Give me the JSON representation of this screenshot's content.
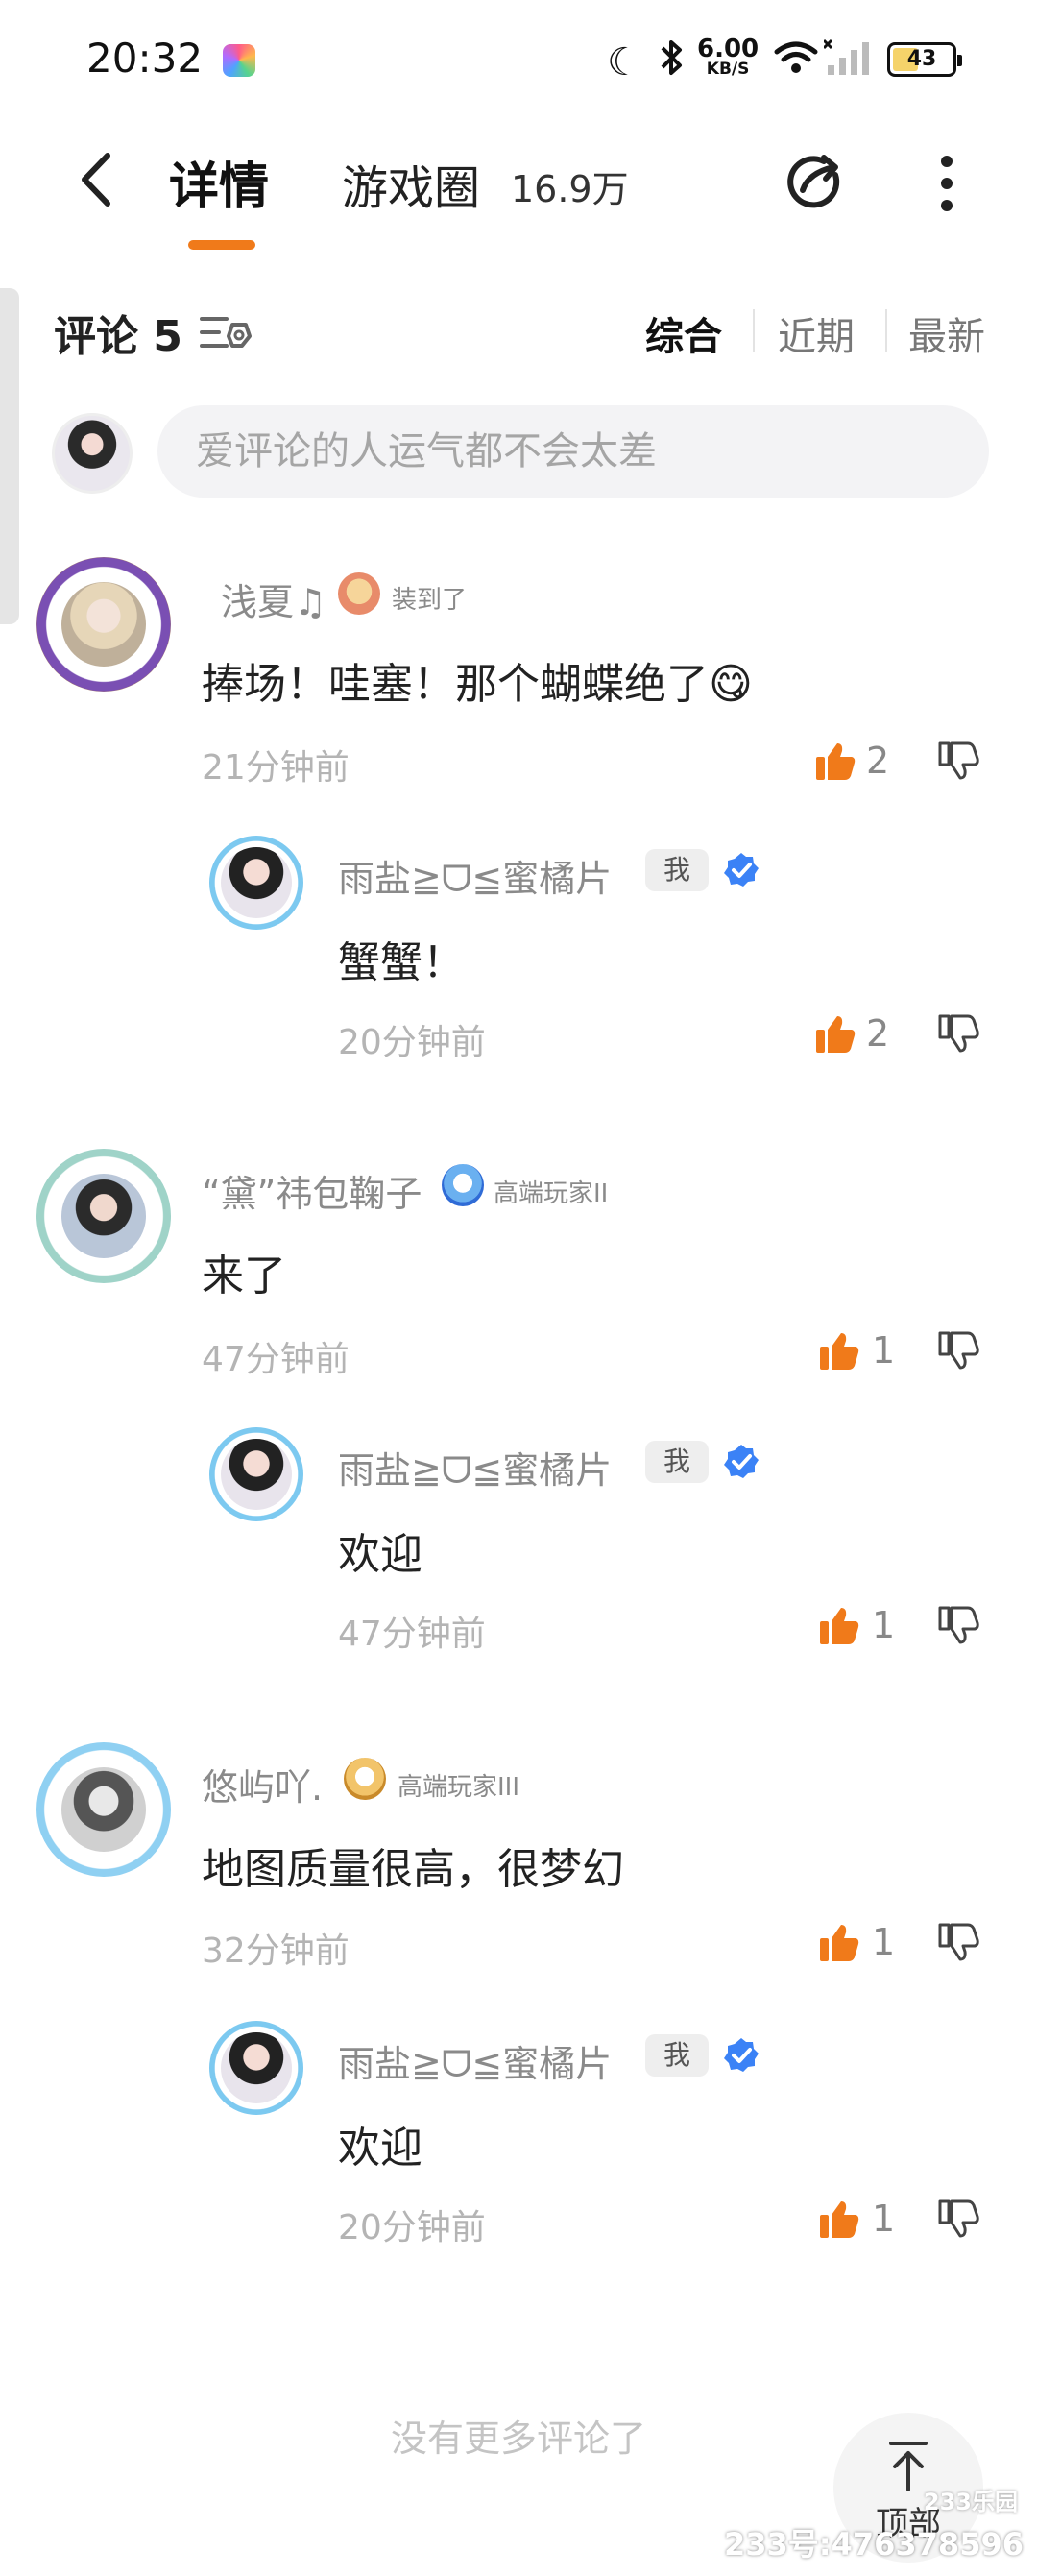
{
  "status_bar": {
    "time": "20:32",
    "net_speed_value": "6.00",
    "net_speed_unit": "KB/S",
    "battery": "43"
  },
  "header": {
    "tab_detail": "详情",
    "tab_circle": "游戏圈",
    "tab_circle_count": "16.9万"
  },
  "comments_header": {
    "title": "评论 5",
    "sort_options": [
      "综合",
      "近期",
      "最新"
    ]
  },
  "input": {
    "placeholder": "爱评论的人运气都不会太差"
  },
  "comments": [
    {
      "user": "浅夏♫",
      "badge": "装到了",
      "text": "捧场！哇塞！那个蝴蝶绝了😋",
      "time": "21分钟前",
      "likes": "2",
      "reply": {
        "user": "雨盐≧ᗜ≦蜜橘片",
        "me_tag": "我",
        "text": "蟹蟹！",
        "time": "20分钟前",
        "likes": "2"
      }
    },
    {
      "user": "“黛”祎包鞠子",
      "badge": "高端玩家II",
      "text": "来了",
      "time": "47分钟前",
      "likes": "1",
      "reply": {
        "user": "雨盐≧ᗜ≦蜜橘片",
        "me_tag": "我",
        "text": "欢迎",
        "time": "47分钟前",
        "likes": "1"
      }
    },
    {
      "user": "悠屿吖.",
      "badge": "高端玩家III",
      "text": "地图质量很高，很梦幻",
      "time": "32分钟前",
      "likes": "1",
      "reply": {
        "user": "雨盐≧ᗜ≦蜜橘片",
        "me_tag": "我",
        "text": "欢迎",
        "time": "20分钟前",
        "likes": "1"
      }
    }
  ],
  "footer": {
    "no_more": "没有更多评论了",
    "top_button": "顶部",
    "watermark": "233号:476378596",
    "watermark_brand": "233乐园"
  },
  "colors": {
    "accent": "#f07a1a",
    "like_orange": "#f07a1a",
    "verified_blue": "#3b82f6"
  }
}
